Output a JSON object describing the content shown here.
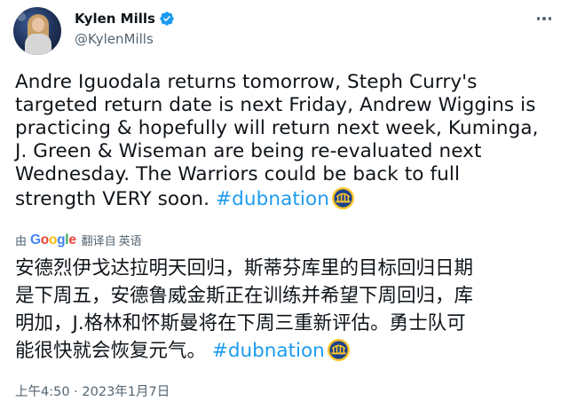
{
  "author": {
    "display_name": "Kylen Mills",
    "handle": "@KylenMills",
    "verified": true
  },
  "tweet": {
    "lines": [
      "Andre Iguodala returns tomorrow, Steph Curry's",
      "targeted return date is next Friday, Andrew Wiggins is",
      "practicing & hopefully will return next week, Kuminga,",
      "J. Green & Wiseman are being re-evaluated next",
      "Wednesday. The Warriors could be back to full"
    ],
    "last_line_text": "strength VERY soon. ",
    "hashtag": "#dubnation"
  },
  "translation": {
    "by_label": "由",
    "provider": "Google",
    "action": "翻译自",
    "language": "英语",
    "lines": [
      "安德烈伊戈达拉明天回归，斯蒂芬库里的目标回归日期",
      "是下周五，安德鲁威金斯正在训练并希望下周回归，库",
      "明加，J.格林和怀斯曼将在下周三重新评估。勇士队可"
    ],
    "last_line_text": "能很快就会恢复元气。 ",
    "hashtag": "#dubnation"
  },
  "timestamp": "上午4:50 · 2023年1月7日",
  "colors": {
    "link": "#1d9bf0",
    "secondary_text": "#536471",
    "verified_badge": "#1d9bf0",
    "warriors_blue": "#1d428a",
    "warriors_gold": "#ffc72c"
  },
  "icons": {
    "more": "more-dots-icon",
    "verified": "verified-badge-icon",
    "team_logo": "warriors-logo-icon"
  }
}
